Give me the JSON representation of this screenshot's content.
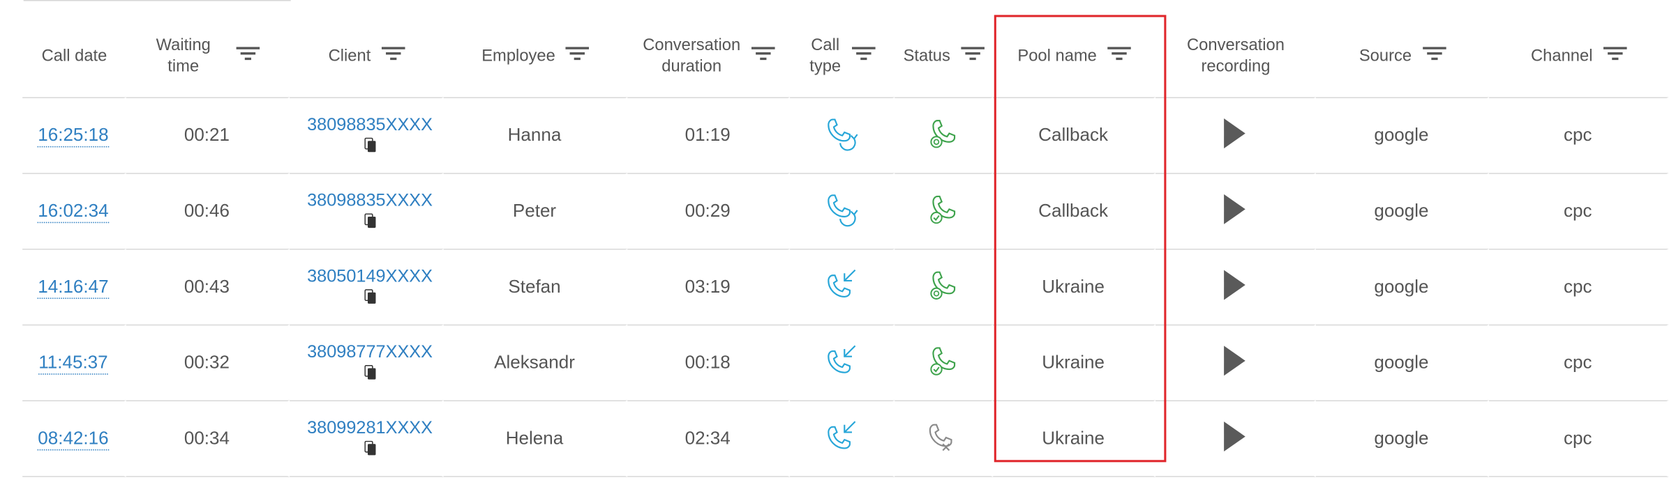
{
  "headers": {
    "call_date": "Call date",
    "waiting_time": [
      "Waiting",
      "time"
    ],
    "client": "Client",
    "employee": "Employee",
    "conversation_duration": [
      "Conversation",
      "duration"
    ],
    "call_type": [
      "Call",
      "type"
    ],
    "status": "Status",
    "pool_name": "Pool name",
    "conversation_recording": [
      "Conversation",
      "recording"
    ],
    "source": "Source",
    "channel": "Channel"
  },
  "icons": {
    "filter": "filter-icon",
    "copy": "copy-icon",
    "play": "play-icon",
    "callback": "callback-phone-icon",
    "incoming": "incoming-call-icon",
    "status_answered_timer": "answered-timer-icon",
    "status_answered_check": "answered-check-icon",
    "status_missed": "missed-call-icon"
  },
  "colors": {
    "link": "#2f7fc1",
    "call_type_icon": "#27a6d8",
    "status_green": "#3fa34d",
    "status_gray": "#8a8a8a",
    "highlight_border": "#e0262b",
    "play": "#5a5a5a"
  },
  "rows": [
    {
      "time": "16:25:18",
      "wait": "00:21",
      "client": "38098835XXXX",
      "employee": "Hanna",
      "duration": "01:19",
      "call_type": "callback",
      "status": "answered-timer",
      "pool": "Callback",
      "source": "google",
      "channel": "cpc"
    },
    {
      "time": "16:02:34",
      "wait": "00:46",
      "client": "38098835XXXX",
      "employee": "Peter",
      "duration": "00:29",
      "call_type": "callback",
      "status": "answered-check",
      "pool": "Callback",
      "source": "google",
      "channel": "cpc"
    },
    {
      "time": "14:16:47",
      "wait": "00:43",
      "client": "38050149XXXX",
      "employee": "Stefan",
      "duration": "03:19",
      "call_type": "incoming",
      "status": "answered-timer",
      "pool": "Ukraine",
      "source": "google",
      "channel": "cpc"
    },
    {
      "time": "11:45:37",
      "wait": "00:32",
      "client": "38098777XXXX",
      "employee": "Aleksandr",
      "duration": "00:18",
      "call_type": "incoming",
      "status": "answered-check",
      "pool": "Ukraine",
      "source": "google",
      "channel": "cpc"
    },
    {
      "time": "08:42:16",
      "wait": "00:34",
      "client": "38099281XXXX",
      "employee": "Helena",
      "duration": "02:34",
      "call_type": "incoming",
      "status": "missed",
      "pool": "Ukraine",
      "source": "google",
      "channel": "cpc"
    }
  ]
}
